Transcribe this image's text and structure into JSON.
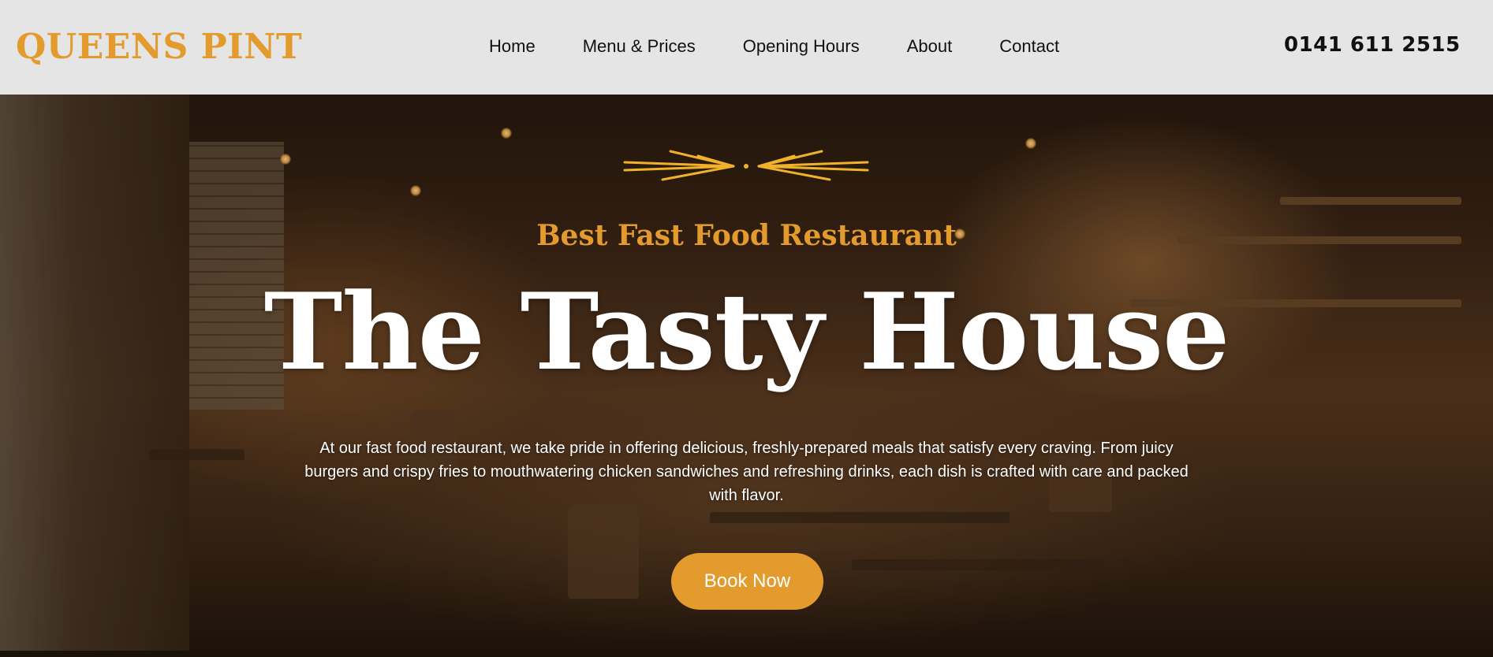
{
  "header": {
    "logo": "QUEENS PINT",
    "nav": [
      "Home",
      "Menu & Prices",
      "Opening Hours",
      "About",
      "Contact"
    ],
    "phone": "0141 611 2515"
  },
  "hero": {
    "eyebrow": "Best Fast Food Restaurant",
    "title": "The Tasty House",
    "description": "At our fast food restaurant, we take pride in offering delicious, freshly-prepared meals that satisfy every craving. From juicy burgers and crispy fries to mouthwatering chicken sandwiches and refreshing drinks, each dish is crafted with care and packed with flavor.",
    "cta": "Book Now",
    "ornament_icon": "decorative-flourish-icon"
  },
  "colors": {
    "accent": "#e39b2e",
    "header_bg": "#ececec",
    "text_dark": "#111111",
    "hero_text": "#ffffff"
  }
}
